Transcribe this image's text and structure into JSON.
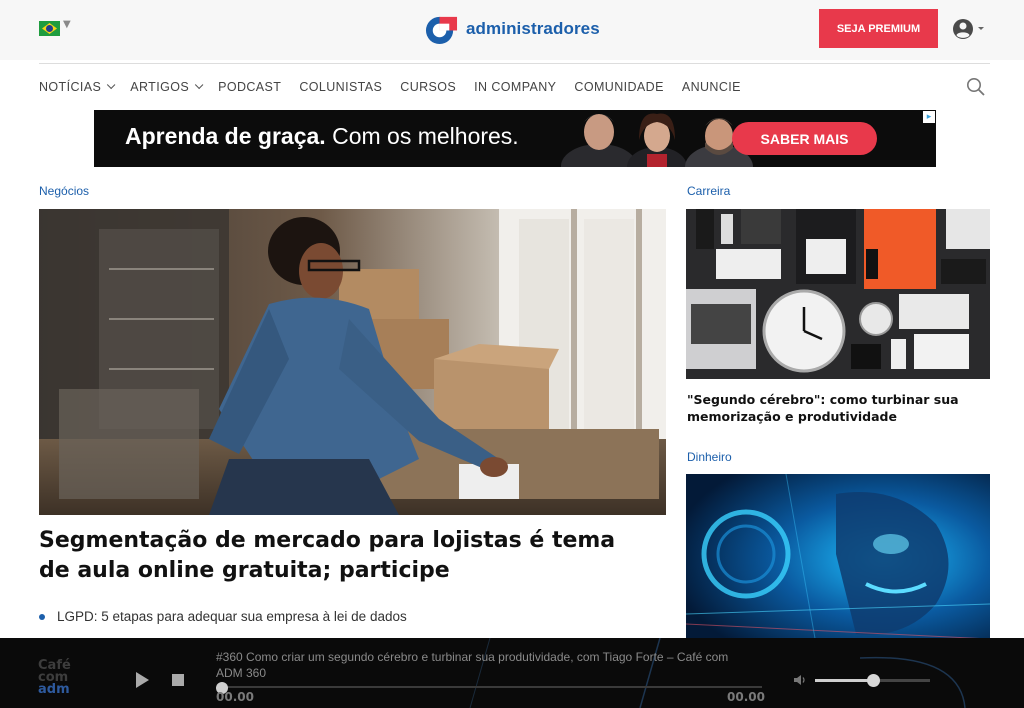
{
  "header": {
    "language_flag": "brazil-flag-icon",
    "logo_text": "administradores",
    "premium_button": "SEJA PREMIUM",
    "user_icon": "user-icon"
  },
  "nav": {
    "items": [
      {
        "label": "NOTÍCIAS",
        "dropdown": true
      },
      {
        "label": "ARTIGOS",
        "dropdown": true
      },
      {
        "label": "PODCAST",
        "dropdown": false
      },
      {
        "label": "COLUNISTAS",
        "dropdown": false
      },
      {
        "label": "CURSOS",
        "dropdown": false
      },
      {
        "label": "IN COMPANY",
        "dropdown": false
      },
      {
        "label": "COMUNIDADE",
        "dropdown": false
      },
      {
        "label": "ANUNCIE",
        "dropdown": false
      }
    ],
    "search_icon": "search-icon"
  },
  "banner": {
    "bold_text": "Aprenda de graça.",
    "text": "Com os melhores.",
    "button": "SABER MAIS"
  },
  "main": {
    "category": "Negócios",
    "headline": "Segmentação de mercado para lojistas é tema de aula online gratuita; participe",
    "related": "LGPD: 5 etapas para adequar sua empresa à lei de dados"
  },
  "sidebar": {
    "items": [
      {
        "category": "Carreira",
        "title": "\"Segundo cérebro\": como turbinar sua memorização e produtividade"
      },
      {
        "category": "Dinheiro",
        "title": ""
      }
    ]
  },
  "player": {
    "logo_line1": "Café",
    "logo_line2": "com",
    "logo_line3": "adm",
    "episode_title": "#360 Como criar um segundo cérebro e turbinar sua produtividade, com Tiago Forte – Café com ADM 360",
    "current_time": "00.00",
    "duration": "00.00",
    "progress": 0,
    "volume": 0.5
  },
  "colors": {
    "brand_blue": "#1c5fab",
    "accent_red": "#e8394b"
  }
}
